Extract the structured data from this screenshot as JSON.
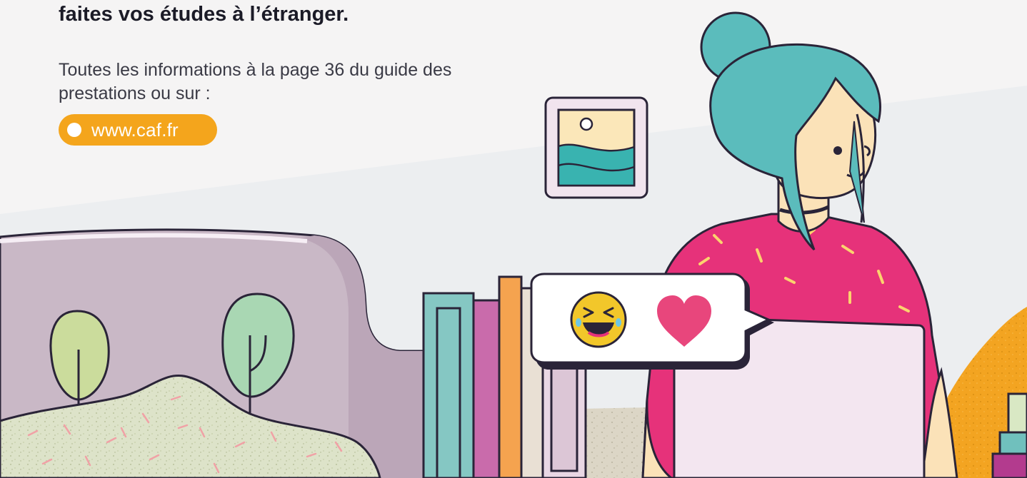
{
  "headline": "faites vos études à l’étranger.",
  "body_text": "Toutes les informations à la page 36 du guide des prestations ou sur :",
  "link": {
    "label": "www.caf.fr"
  },
  "icons": [
    "laughing-emoji-icon",
    "heart-icon",
    "dot-icon"
  ],
  "colors": {
    "accent": "#f4a51c",
    "hair": "#5bbcbc",
    "shirt": "#e6327a",
    "heart": "#e8467c",
    "sofa": "#c8b6c5",
    "laptop": "#f3e6f0"
  }
}
